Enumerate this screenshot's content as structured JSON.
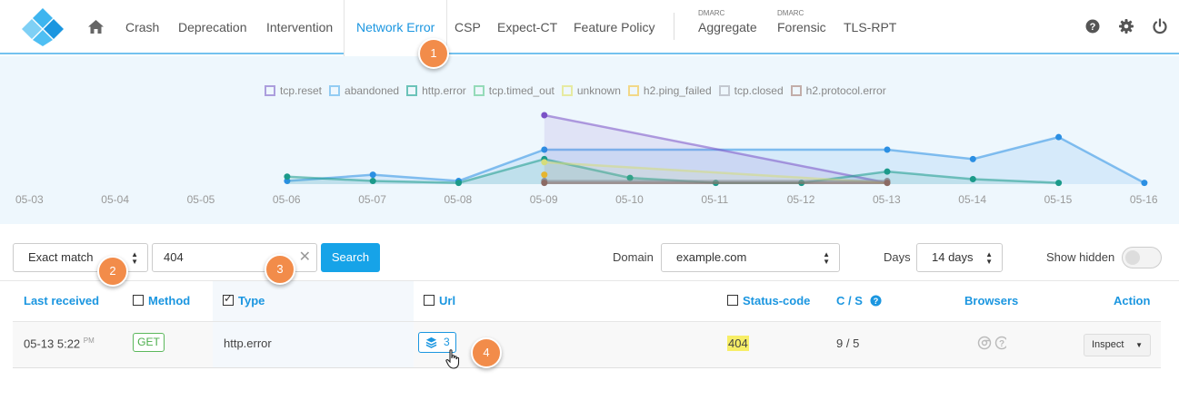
{
  "nav": {
    "home_icon": "home-icon",
    "items": [
      "Crash",
      "Deprecation",
      "Intervention",
      "Network Error",
      "CSP",
      "Expect-CT",
      "Feature Policy"
    ],
    "active": "Network Error",
    "dmarc_small": "DMARC",
    "aggregate": "Aggregate",
    "forensic": "Forensic",
    "tlsrpt": "TLS-RPT",
    "right_icons": [
      "help-icon",
      "gear-icon",
      "power-icon"
    ]
  },
  "badges": [
    "1",
    "2",
    "3",
    "4"
  ],
  "chart_data": {
    "type": "area",
    "legend": [
      {
        "name": "tcp.reset",
        "color": "#9b87d4"
      },
      {
        "name": "abandoned",
        "color": "#7cc0f0"
      },
      {
        "name": "http.error",
        "color": "#4ab5a8"
      },
      {
        "name": "tcp.timed_out",
        "color": "#7ed3a8"
      },
      {
        "name": "unknown",
        "color": "#e4e68a"
      },
      {
        "name": "h2.ping_failed",
        "color": "#f3d06a"
      },
      {
        "name": "tcp.closed",
        "color": "#b8bcc4"
      },
      {
        "name": "h2.protocol.error",
        "color": "#b79a94"
      }
    ],
    "x": [
      "05-03",
      "05-04",
      "05-05",
      "05-06",
      "05-07",
      "05-08",
      "05-09",
      "05-10",
      "05-11",
      "05-12",
      "05-13",
      "05-14",
      "05-15",
      "05-16"
    ],
    "ylim": [
      0,
      11
    ],
    "series": [
      {
        "name": "abandoned",
        "color": "#2b8fe3",
        "points": [
          [
            3,
            0.5
          ],
          [
            4,
            1.5
          ],
          [
            5,
            0.5
          ],
          [
            6,
            5.5
          ],
          [
            10,
            5.5
          ],
          [
            11,
            4
          ],
          [
            12,
            7.5
          ],
          [
            13,
            0.2
          ]
        ]
      },
      {
        "name": "tcp.reset",
        "color": "#7b52c7",
        "points": [
          [
            6,
            11
          ],
          [
            10,
            0.2
          ]
        ]
      },
      {
        "name": "http.error",
        "color": "#1b9a8a",
        "points": [
          [
            3,
            1.2
          ],
          [
            4,
            0.5
          ],
          [
            5,
            0.2
          ],
          [
            6,
            4
          ],
          [
            7,
            1
          ],
          [
            8,
            0.2
          ],
          [
            9,
            0.2
          ],
          [
            10,
            2
          ],
          [
            11,
            0.8
          ],
          [
            12,
            0.2
          ]
        ]
      },
      {
        "name": "unknown",
        "color": "#d5dc7a",
        "points": [
          [
            6,
            3.5
          ],
          [
            10,
            0.2
          ]
        ]
      },
      {
        "name": "h2.ping_failed",
        "color": "#e5b52f",
        "points": [
          [
            6,
            1.5
          ]
        ]
      },
      {
        "name": "tcp.closed",
        "color": "#8a8f98",
        "points": [
          [
            6,
            0.5
          ],
          [
            10,
            0.5
          ]
        ]
      },
      {
        "name": "h2.protocol.error",
        "color": "#8b6a64",
        "points": [
          [
            6,
            0.2
          ],
          [
            10,
            0.2
          ]
        ]
      }
    ]
  },
  "filter": {
    "match_mode": "Exact match",
    "query": "404",
    "search_label": "Search",
    "domain_label": "Domain",
    "domain_value": "example.com",
    "days_label": "Days",
    "days_value": "14 days",
    "show_hidden_label": "Show hidden"
  },
  "table": {
    "headers": {
      "last_received": "Last received",
      "method": "Method",
      "type": "Type",
      "url": "Url",
      "status_code": "Status-code",
      "cs": "C / S",
      "browsers": "Browsers",
      "action": "Action"
    },
    "row": {
      "date": "05-13 5:22",
      "ampm": "PM",
      "method": "GET",
      "type": "http.error",
      "url_count": "3",
      "status": "404",
      "cs": "9 / 5",
      "action": "Inspect"
    }
  }
}
